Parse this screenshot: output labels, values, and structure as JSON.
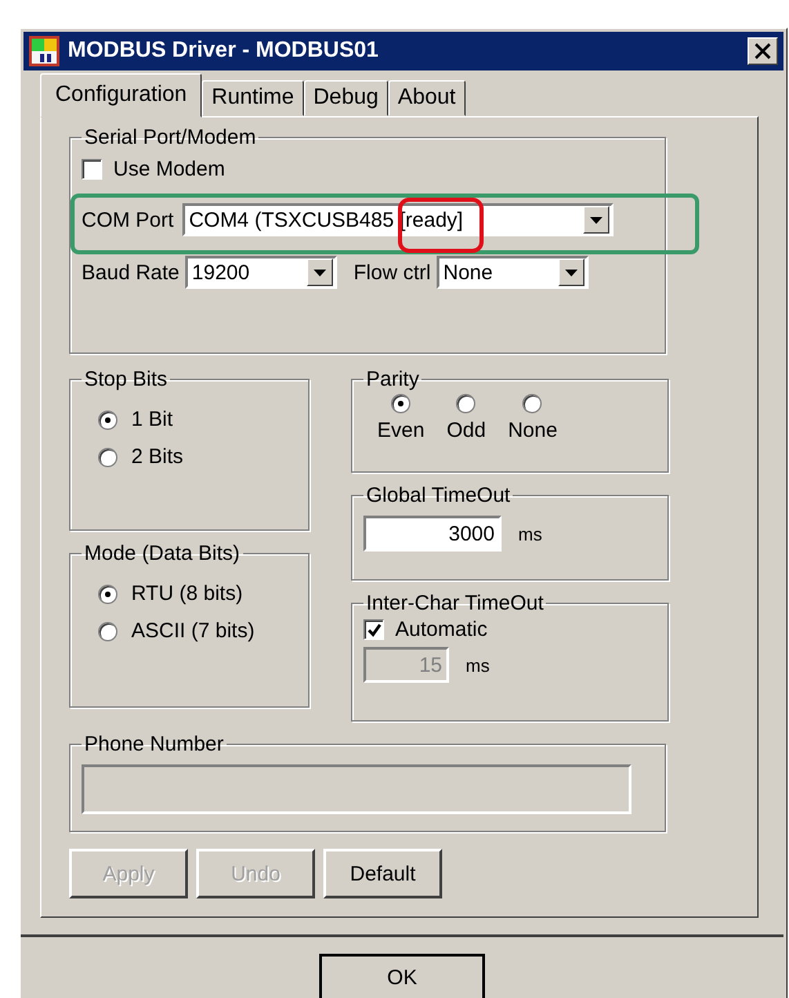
{
  "window": {
    "title": "MODBUS Driver - MODBUS01"
  },
  "tabs": [
    {
      "label": "Configuration",
      "selected": true
    },
    {
      "label": "Runtime",
      "selected": false
    },
    {
      "label": "Debug",
      "selected": false
    },
    {
      "label": "About",
      "selected": false
    }
  ],
  "serial_port": {
    "title": "Serial Port/Modem",
    "use_modem": {
      "label": "Use Modem",
      "checked": false
    },
    "com_port": {
      "label": "COM Port",
      "value": "COM4 (TSXCUSB485 [ready]"
    },
    "baud_rate": {
      "label": "Baud Rate",
      "value": "19200"
    },
    "flow_ctrl": {
      "label": "Flow ctrl",
      "value": "None"
    }
  },
  "stop_bits": {
    "title": "Stop Bits",
    "options": [
      {
        "label": "1 Bit",
        "selected": true
      },
      {
        "label": "2 Bits",
        "selected": false
      }
    ]
  },
  "mode": {
    "title": "Mode (Data Bits)",
    "options": [
      {
        "label": "RTU (8 bits)",
        "selected": true
      },
      {
        "label": "ASCII (7 bits)",
        "selected": false
      }
    ]
  },
  "parity": {
    "title": "Parity",
    "options": [
      {
        "label": "Even",
        "selected": true
      },
      {
        "label": "Odd",
        "selected": false
      },
      {
        "label": "None",
        "selected": false
      }
    ]
  },
  "global_timeout": {
    "title": "Global TimeOut",
    "value": "3000",
    "unit": "ms"
  },
  "inter_char_timeout": {
    "title": "Inter-Char TimeOut",
    "automatic": {
      "label": "Automatic",
      "checked": true
    },
    "value": "15",
    "unit": "ms",
    "disabled": true
  },
  "phone_number": {
    "title": "Phone Number",
    "disabled": true
  },
  "buttons": [
    {
      "label": "Apply",
      "disabled": true
    },
    {
      "label": "Undo",
      "disabled": true
    },
    {
      "label": "Default",
      "disabled": false
    }
  ],
  "ok_button": {
    "label": "OK"
  }
}
